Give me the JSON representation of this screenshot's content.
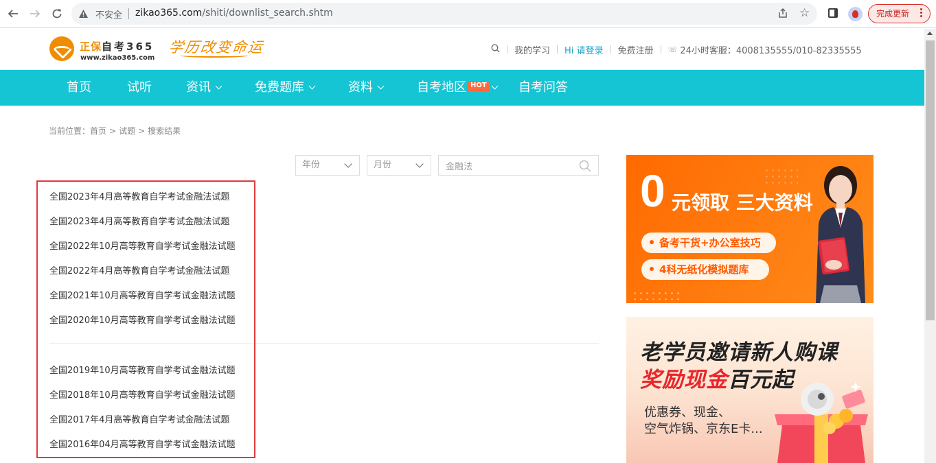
{
  "browser": {
    "insecure_label": "不安全",
    "url_host": "zikao365.com",
    "url_path": "/shiti/downlist_search.shtm",
    "update_button": "完成更新"
  },
  "header": {
    "brand_name": "正保",
    "brand_suffix": "自考365",
    "brand_url": "www.zikao365.com",
    "slogan": "学历改变命运",
    "links": {
      "my_study": "我的学习",
      "login": "Hi 请登录",
      "register": "免费注册",
      "hotline": "24小时客服：4008135555/010-82335555"
    }
  },
  "nav": {
    "items": [
      {
        "label": "首页"
      },
      {
        "label": "试听"
      },
      {
        "label": "资讯"
      },
      {
        "label": "免费题库"
      },
      {
        "label": "资料"
      },
      {
        "label": "自考地区"
      },
      {
        "label": "自考问答"
      }
    ],
    "hot_badge": "HOT"
  },
  "breadcrumb": {
    "prefix": "当前位置：",
    "home": "首页",
    "section": "试题",
    "current": "搜索结果"
  },
  "filters": {
    "year": "年份",
    "month": "月份",
    "search_value": "金融法"
  },
  "results": [
    "全国2023年4月高等教育自学考试金融法试题",
    "全国2023年4月高等教育自学考试金融法试题",
    "全国2022年10月高等教育自学考试金融法试题",
    "全国2022年4月高等教育自学考试金融法试题",
    "全国2021年10月高等教育自学考试金融法试题",
    "全国2020年10月高等教育自学考试金融法试题",
    "全国2019年10月高等教育自学考试金融法试题",
    "全国2018年10月高等教育自学考试金融法试题",
    "全国2017年4月高等教育自学考试金融法试题",
    "全国2016年04月高等教育自学考试金融法试题"
  ],
  "banners": {
    "first": {
      "zero": "0",
      "title": "元领取 三大资料",
      "pill1": "备考干货+办公室技巧",
      "pill2": "4科无纸化模拟题库"
    },
    "second": {
      "line1": "老学员邀请新人购课",
      "line2_red": "奖励现金",
      "line2_rest": "百元起",
      "sub1": "优惠券、现金、",
      "sub2": "空气炸锅、京东E卡..."
    }
  },
  "colors": {
    "nav_bg": "#15c5d4",
    "brand_orange": "#f08c00",
    "highlight_red": "#e0393b",
    "login_link": "#20a5c9"
  }
}
